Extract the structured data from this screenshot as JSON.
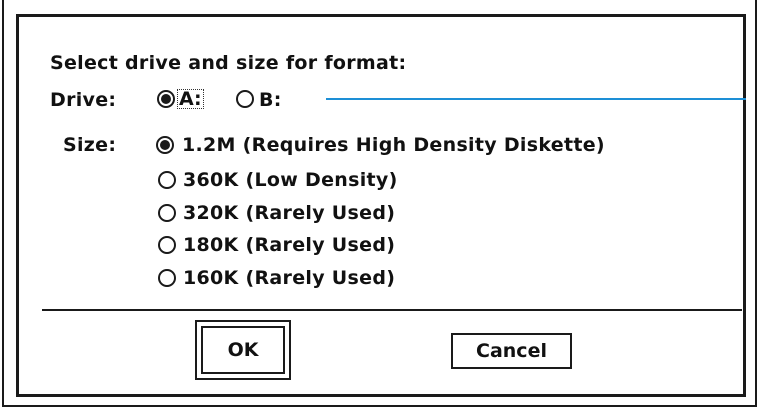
{
  "dialog": {
    "prompt": "Select drive and size for format:",
    "drive": {
      "label": "Drive:",
      "options": [
        {
          "label": "A:",
          "selected": true
        },
        {
          "label": "B:",
          "selected": false
        }
      ]
    },
    "size": {
      "label": "Size:",
      "options": [
        {
          "label": "1.2M (Requires High Density Diskette)",
          "selected": true
        },
        {
          "label": "360K (Low Density)",
          "selected": false
        },
        {
          "label": "320K (Rarely Used)",
          "selected": false
        },
        {
          "label": "180K (Rarely Used)",
          "selected": false
        },
        {
          "label": "160K (Rarely Used)",
          "selected": false
        }
      ]
    },
    "buttons": {
      "ok": "OK",
      "cancel": "Cancel"
    }
  },
  "colors": {
    "frame": "#1a1a1a",
    "callout_line": "#1d8fd6",
    "background": "#ffffff"
  }
}
